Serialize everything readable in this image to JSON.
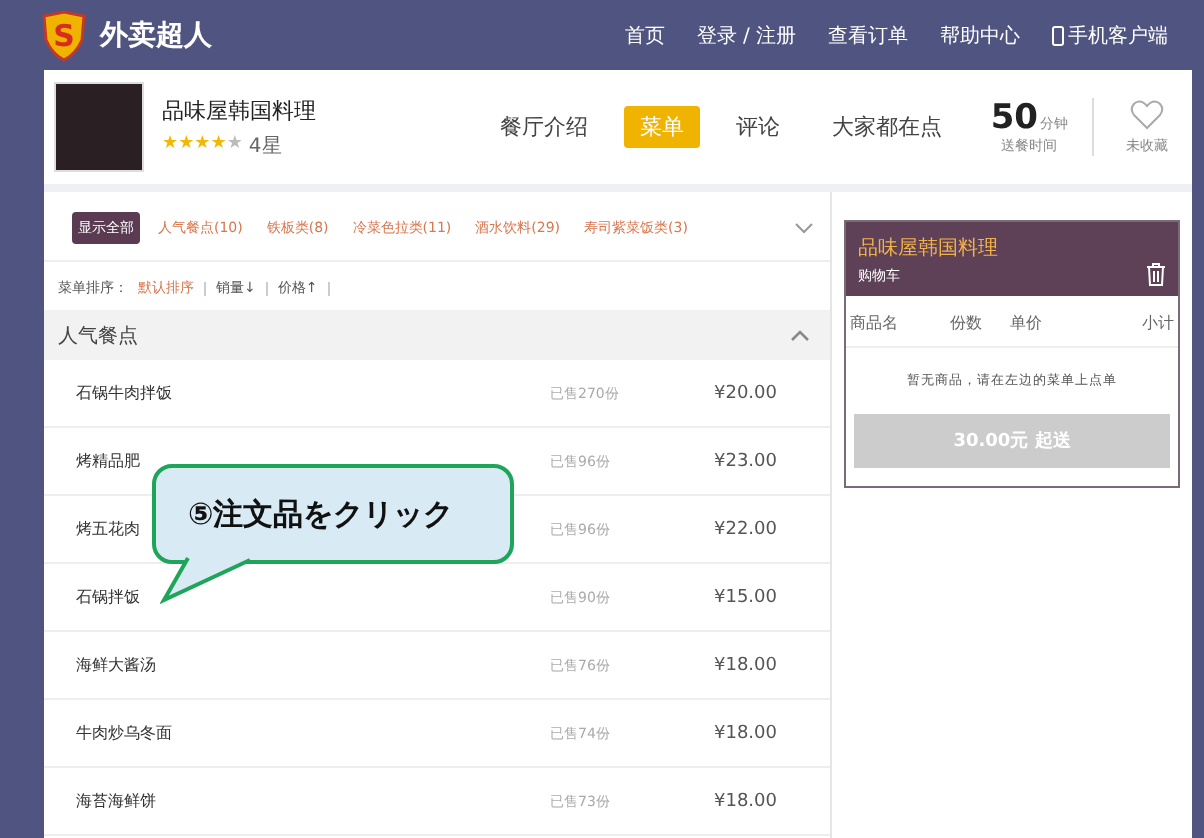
{
  "header": {
    "logo_mark": "S",
    "brand": "外卖超人",
    "nav": [
      "首页",
      "登录 / 注册",
      "查看订单",
      "帮助中心"
    ],
    "app_link": "手机客户端"
  },
  "store": {
    "name": "品味屋韩国料理",
    "stars": 4,
    "rating": "4星",
    "tabs": [
      {
        "label": "餐厅介绍",
        "selected": false
      },
      {
        "label": "菜单",
        "selected": true
      },
      {
        "label": "评论",
        "selected": false
      },
      {
        "label": "大家都在点",
        "selected": false
      }
    ],
    "delivery_time": "50",
    "delivery_unit": "分钟",
    "delivery_label": "送餐时间",
    "favorite": {
      "label": "未收藏",
      "on": false
    }
  },
  "categories": [
    {
      "label": "显示全部",
      "selected": true
    },
    {
      "label": "人气餐点(10)",
      "selected": false
    },
    {
      "label": "铁板类(8)",
      "selected": false
    },
    {
      "label": "冷菜色拉类(11)",
      "selected": false
    },
    {
      "label": "酒水饮料(29)",
      "selected": false
    },
    {
      "label": "寿司紫菜饭类(3)",
      "selected": false
    }
  ],
  "sort": {
    "label": "菜单排序：",
    "options": [
      {
        "label": "默认排序",
        "selected": true
      },
      {
        "label": "销量↓",
        "selected": false
      },
      {
        "label": "价格↑",
        "selected": false
      }
    ]
  },
  "section": {
    "title": "人气餐点",
    "expanded": true
  },
  "dishes": [
    {
      "name": "石锅牛肉拌饭",
      "sold": "已售270份",
      "price": "¥20.00"
    },
    {
      "name": "烤精品肥",
      "sold": "已售96份",
      "price": "¥23.00"
    },
    {
      "name": "烤五花肉",
      "sold": "已售96份",
      "price": "¥22.00"
    },
    {
      "name": "石锅拌饭",
      "sold": "已售90份",
      "price": "¥15.00"
    },
    {
      "name": "海鲜大酱汤",
      "sold": "已售76份",
      "price": "¥18.00"
    },
    {
      "name": "牛肉炒乌冬面",
      "sold": "已售74份",
      "price": "¥18.00"
    },
    {
      "name": "海苔海鲜饼",
      "sold": "已售73份",
      "price": "¥18.00"
    }
  ],
  "cart": {
    "store": "品味屋韩国料理",
    "title": "购物车",
    "columns": [
      "商品名",
      "份数",
      "单价",
      "小计"
    ],
    "empty_message": "暂无商品，请在左边的菜单上点单",
    "checkout": {
      "label": "30.00元 起送",
      "disabled": true
    }
  },
  "callout": {
    "text": "⑤注文品をクリック"
  }
}
